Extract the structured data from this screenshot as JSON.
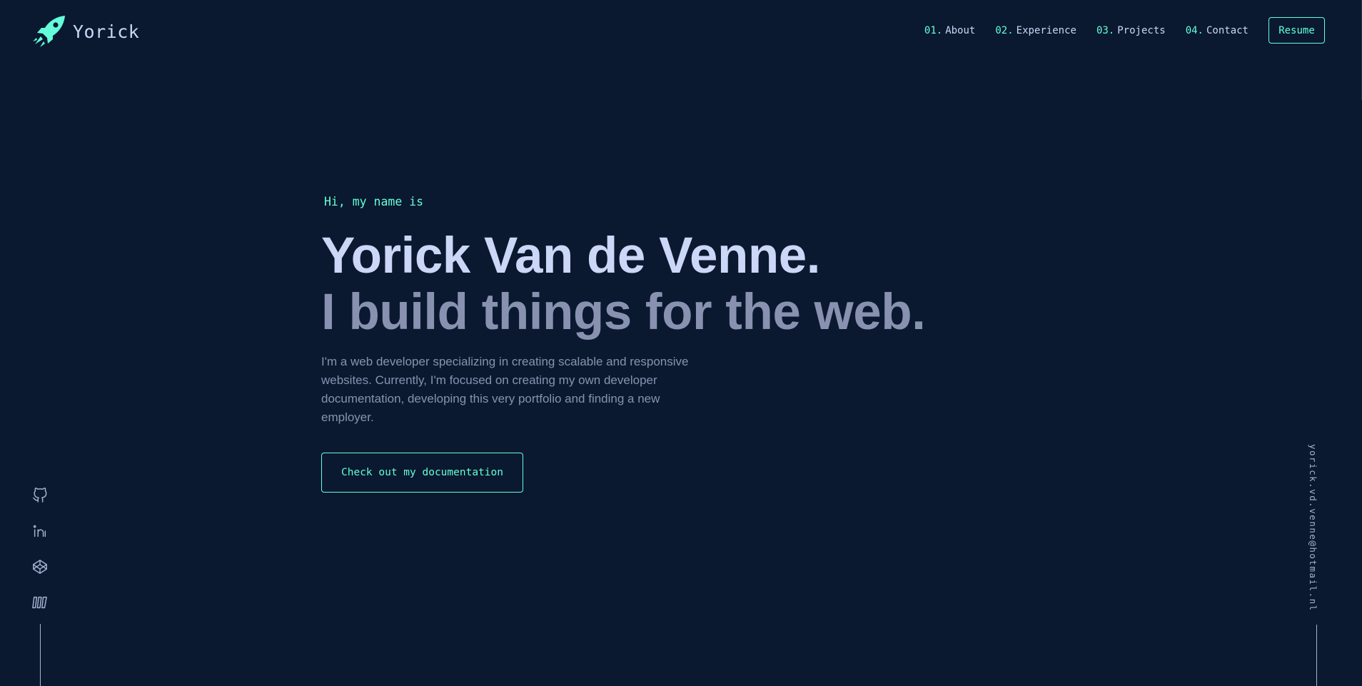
{
  "brand": {
    "name": "Yorick",
    "logo_icon": "rocket-icon",
    "accent_color": "#64ffda",
    "background_color": "#0a192f"
  },
  "nav": {
    "items": [
      {
        "number": "01.",
        "label": "About"
      },
      {
        "number": "02.",
        "label": "Experience"
      },
      {
        "number": "03.",
        "label": "Projects"
      },
      {
        "number": "04.",
        "label": "Contact"
      }
    ],
    "resume_label": "Resume"
  },
  "hero": {
    "greeting": "Hi, my name is",
    "name": "Yorick Van de Venne.",
    "tagline": "I build things for the web.",
    "intro": "I'm a web developer specializing in creating scalable and responsive websites. Currently, I'm focused on creating my own developer documentation, developing this very portfolio and finding a new employer.",
    "cta_label": "Check out my documentation"
  },
  "social": {
    "icons": [
      "github-icon",
      "linkedin-icon",
      "codepen-icon",
      "documentation-icon"
    ]
  },
  "contact": {
    "email": "yorick.vd.venne@hotmail.nl"
  }
}
